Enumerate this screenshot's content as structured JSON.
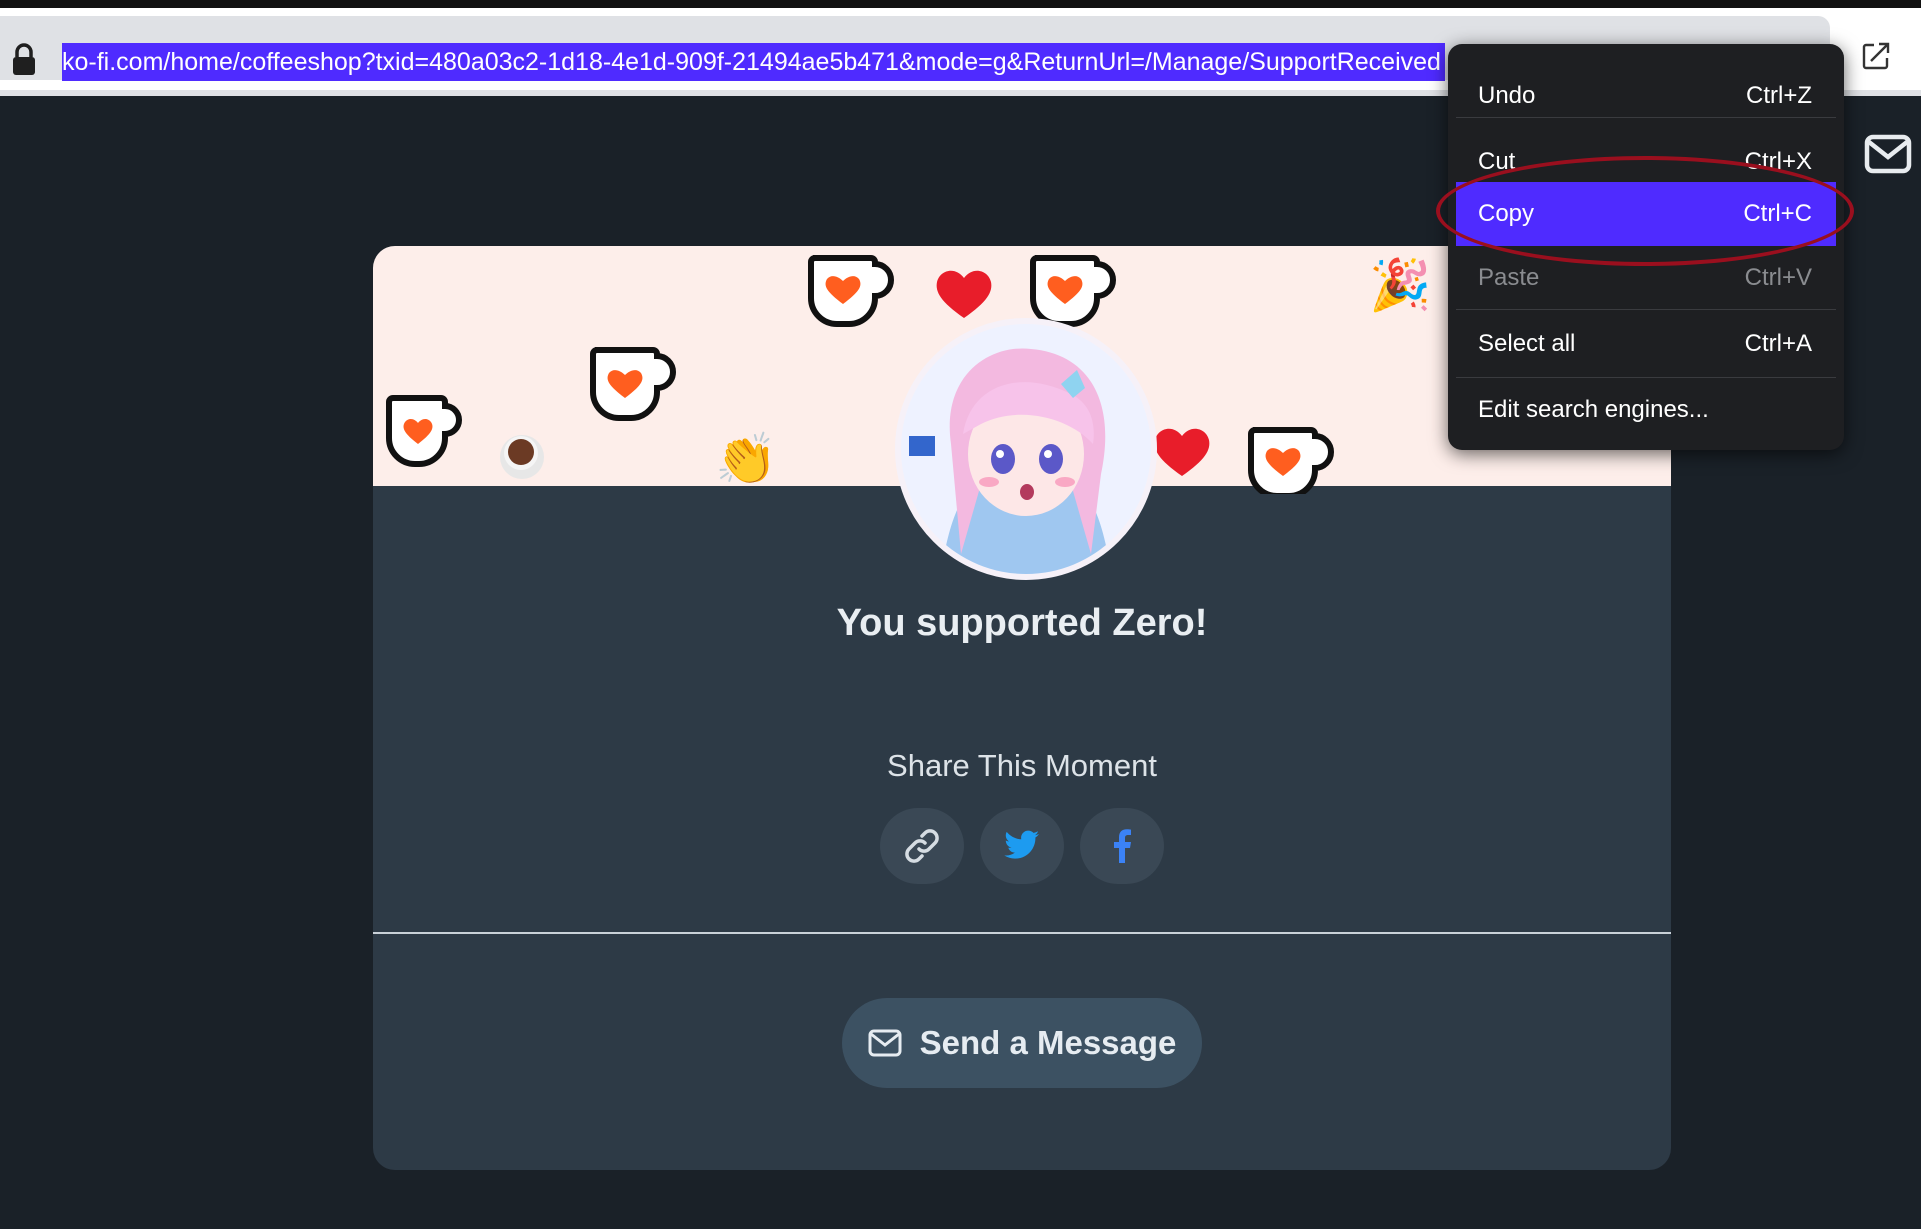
{
  "browser": {
    "url": "ko-fi.com/home/coffeeshop?txid=480a03c2-1d18-4e1d-909f-21494ae5b471&mode=g&ReturnUrl=/Manage/SupportReceived"
  },
  "context_menu": {
    "items": [
      {
        "label": "Undo",
        "shortcut": "Ctrl+Z",
        "state": "enabled"
      },
      {
        "label": "Cut",
        "shortcut": "Ctrl+X",
        "state": "enabled"
      },
      {
        "label": "Copy",
        "shortcut": "Ctrl+C",
        "state": "highlighted"
      },
      {
        "label": "Paste",
        "shortcut": "Ctrl+V",
        "state": "disabled"
      },
      {
        "label": "Select all",
        "shortcut": "Ctrl+A",
        "state": "enabled"
      },
      {
        "label": "Edit search engines...",
        "shortcut": "",
        "state": "enabled"
      }
    ]
  },
  "card": {
    "title": "You supported Zero!",
    "share_title": "Share This Moment",
    "share_buttons": [
      "link-icon",
      "twitter-icon",
      "facebook-icon"
    ],
    "send_message_label": "Send a Message"
  },
  "colors": {
    "page_bg": "#1a2128",
    "card_bg": "#2d3a46",
    "banner_bg": "#fdeeea",
    "selection": "#4f2bff",
    "annotation_ring": "#9a0f1e",
    "kofi_orange": "#ff5e1f"
  }
}
